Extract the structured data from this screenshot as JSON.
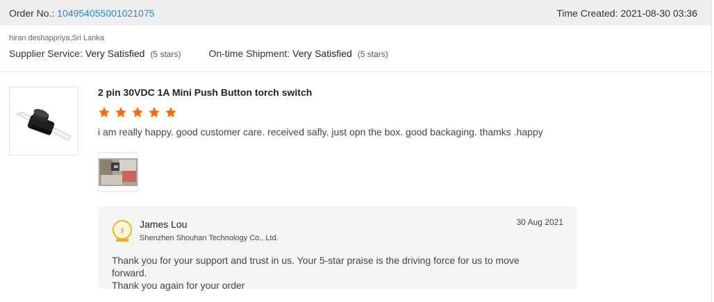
{
  "header": {
    "order_label": "Order No.:",
    "order_number": "104954055001021075",
    "time_created_label": "Time Created:",
    "time_created_value": "2021-08-30 03:36"
  },
  "buyer": {
    "name_location": "hiran deshappriya,Sri Lanka",
    "supplier_service_label": "Supplier Service:",
    "supplier_service_value": "Very Satisfied",
    "supplier_service_stars": "(5 stars)",
    "shipment_label": "On-time Shipment:",
    "shipment_value": "Very Satisfied",
    "shipment_stars": "(5 stars)"
  },
  "product": {
    "title": "2 pin 30VDC 1A Mini Push Button torch switch",
    "rating": 5,
    "rating_max": 5,
    "star_color": "#ff6a00"
  },
  "review": {
    "text": "i am really happy. good customer care. received safly. just opn the box. good backaging. thamks .happy"
  },
  "reply": {
    "name": "James Lou",
    "company": "Shenzhen Shouhan Technology Co., Ltd.",
    "date": "30 Aug 2021",
    "text_line1": "Thank you for your support and trust in us. Your 5-star praise is the driving force for us to move forward.",
    "text_line2": "Thank you again for your order"
  },
  "colors": {
    "link": "#1e88d8",
    "header_bg": "#eeeeee",
    "reply_bg": "#f4f5f6"
  }
}
